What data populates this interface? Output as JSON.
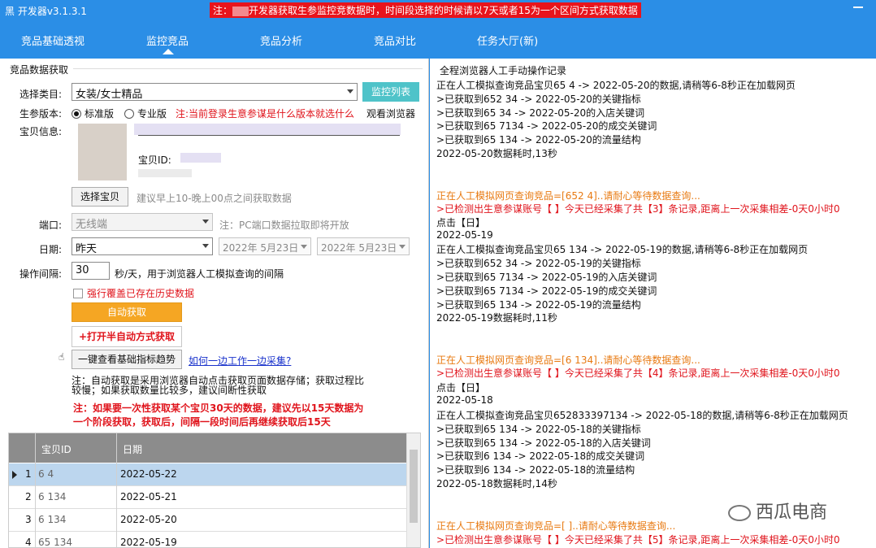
{
  "titlebar": {
    "app_title": "黑   开发器v3.1.3.1",
    "notice_prefix": "注：",
    "notice_text": "开发器获取生参监控竞数据时，时间段选择的时候请以7天或者15为一个区间方式获取数据"
  },
  "nav": {
    "items": [
      "竞品基础透视",
      "监控竞品",
      "竞品分析",
      "竞品对比",
      "任务大厅(新)"
    ],
    "active": "监控竞品"
  },
  "left": {
    "group_title": "竞品数据获取",
    "category_label": "选择类目:",
    "category_value": "女装/女士精品",
    "monitor_list_btn": "监控列表",
    "version_label": "生参版本:",
    "version_standard": "标准版",
    "version_pro": "专业版",
    "version_note": "注:当前登录生意参谋是什么版本就选什么",
    "view_browser": "观看浏览器",
    "baby_info_label": "宝贝信息:",
    "baby_id_label": "宝贝ID:",
    "select_baby_btn": "选择宝贝",
    "select_hint": "建议早上10-晚上00点之间获取数据",
    "port_label": "端口:",
    "port_value": "无线端",
    "port_note": "注：PC端口数据拉取即将开放",
    "date_label": "日期:",
    "date_value": "昨天",
    "date_from": "2022年  5月23日",
    "date_to": "2022年  5月23日",
    "interval_label": "操作间隔:",
    "interval_value": "30",
    "interval_hint": "秒/天，用于浏览器人工模拟查询的间隔",
    "overwrite_label": "强行覆盖已存在历史数据",
    "auto_btn": "自动获取",
    "semi_auto_btn": "+打开半自动方式获取",
    "trend_btn": "一键查看基础指标趋势",
    "help_link": "如何一边工作一边采集?",
    "note1": "注：自动获取是采用浏览器自动点击获取页面数据存储；获取过程比",
    "note2": "较慢；如果获取数量比较多，建议间断性获取",
    "warn1": "注：如果要一次性获取某个宝贝30天的数据，建议先以15天数据为",
    "warn2": "一个阶段获取，获取后，间隔一段时间后再继续获取后15天"
  },
  "grid": {
    "headers": [
      "宝贝ID",
      "日期"
    ],
    "rows": [
      {
        "no": "1",
        "id": "6            4",
        "date": "2022-05-22"
      },
      {
        "no": "2",
        "id": "6          134",
        "date": "2022-05-21"
      },
      {
        "no": "3",
        "id": "6          134",
        "date": "2022-05-20"
      },
      {
        "no": "4",
        "id": "65         134",
        "date": "2022-05-19"
      }
    ]
  },
  "log": {
    "title": "全程浏览器人工手动操作记录",
    "lines": [
      {
        "text": "正在人工模拟查询竞品宝贝65        4  -> 2022-05-20的数据,请稍等6-8秒正在加载网页",
        "color": "normal"
      },
      {
        "text": ">已获取到652        34 -> 2022-05-20的关键指标",
        "color": "normal"
      },
      {
        "text": ">已获取到65         34 -> 2022-05-20的入店关键词",
        "color": "normal"
      },
      {
        "text": ">已获取到65        7134 -> 2022-05-20的成交关键词",
        "color": "normal"
      },
      {
        "text": ">已获取到65         134 -> 2022-05-20的流量结构",
        "color": "normal"
      },
      {
        "text": "2022-05-20数据耗时,13秒",
        "color": "normal"
      },
      {
        "text": "正在人工模拟网页查询竞品=[652         4]..请耐心等待数据查询...",
        "color": "orange"
      },
      {
        "text": ">已检测出生意参谋账号【        】今天已经采集了共【3】条记录,距离上一次采集相差-0天0小时0",
        "color": "red"
      },
      {
        "text": "点击【日】",
        "color": "normal"
      },
      {
        "text": "2022-05-19",
        "color": "normal"
      },
      {
        "text": "正在人工模拟查询竞品宝贝65         134  -> 2022-05-19的数据,请稍等6-8秒正在加载网页",
        "color": "normal"
      },
      {
        "text": ">已获取到652        34 -> 2022-05-19的关键指标",
        "color": "normal"
      },
      {
        "text": ">已获取到65        7134 -> 2022-05-19的入店关键词",
        "color": "normal"
      },
      {
        "text": ">已获取到65        7134 -> 2022-05-19的成交关键词",
        "color": "normal"
      },
      {
        "text": ">已获取到65         134 -> 2022-05-19的流量结构",
        "color": "normal"
      },
      {
        "text": "2022-05-19数据耗时,11秒",
        "color": "normal"
      },
      {
        "text": "正在人工模拟网页查询竞品=[6          134]..请耐心等待数据查询...",
        "color": "orange"
      },
      {
        "text": ">已检测出生意参谋账号【        】今天已经采集了共【4】条记录,距离上一次采集相差-0天0小时0",
        "color": "red"
      },
      {
        "text": "点击【日】",
        "color": "normal"
      },
      {
        "text": "2022-05-18",
        "color": "normal"
      },
      {
        "text": "正在人工模拟查询竞品宝贝652833397134  -> 2022-05-18的数据,请稍等6-8秒正在加载网页",
        "color": "normal"
      },
      {
        "text": ">已获取到65         134 -> 2022-05-18的关键指标",
        "color": "normal"
      },
      {
        "text": ">已获取到65         134 -> 2022-05-18的入店关键词",
        "color": "normal"
      },
      {
        "text": ">已获取到6          134 -> 2022-05-18的成交关键词",
        "color": "normal"
      },
      {
        "text": ">已获取到6          134 -> 2022-05-18的流量结构",
        "color": "normal"
      },
      {
        "text": "2022-05-18数据耗时,14秒",
        "color": "normal"
      },
      {
        "text": "正在人工模拟网页查询竞品=[               ]..请耐心等待数据查询...",
        "color": "orange"
      },
      {
        "text": ">已检测出生意参谋账号【        】今天已经采集了共【5】条记录,距离上一次采集相差-0天0小时0",
        "color": "red"
      }
    ]
  },
  "watermark": "西瓜电商"
}
